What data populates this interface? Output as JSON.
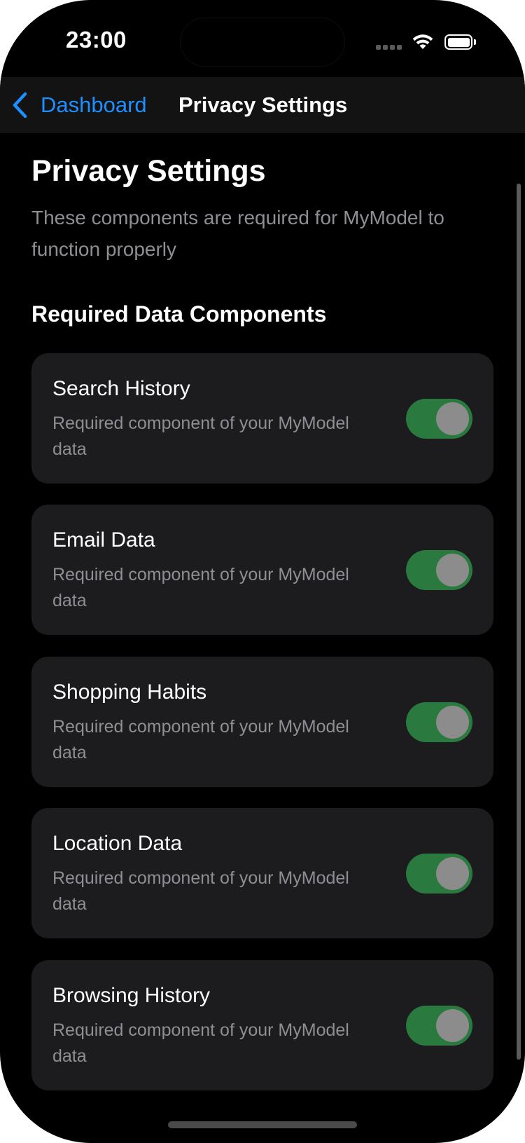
{
  "status_bar": {
    "time": "23:00"
  },
  "nav": {
    "back_label": "Dashboard",
    "title": "Privacy Settings"
  },
  "page": {
    "title": "Privacy Settings",
    "subtitle": "These components are required for MyModel to function properly",
    "section_header": "Required Data Components"
  },
  "items": [
    {
      "title": "Search History",
      "description": "Required component of your MyModel data",
      "enabled": true
    },
    {
      "title": "Email Data",
      "description": "Required component of your MyModel data",
      "enabled": true
    },
    {
      "title": "Shopping Habits",
      "description": "Required component of your MyModel data",
      "enabled": true
    },
    {
      "title": "Location Data",
      "description": "Required component of your MyModel data",
      "enabled": true
    },
    {
      "title": "Browsing History",
      "description": "Required component of your MyModel data",
      "enabled": true
    }
  ],
  "colors": {
    "accent": "#1e8fff",
    "toggle_on": "#2a7a3f",
    "card_background": "#1c1c1e",
    "background": "#000000"
  },
  "icons": {
    "back": "chevron-left-icon",
    "signal": "signal-dots-icon",
    "wifi": "wifi-icon",
    "battery": "battery-icon"
  }
}
